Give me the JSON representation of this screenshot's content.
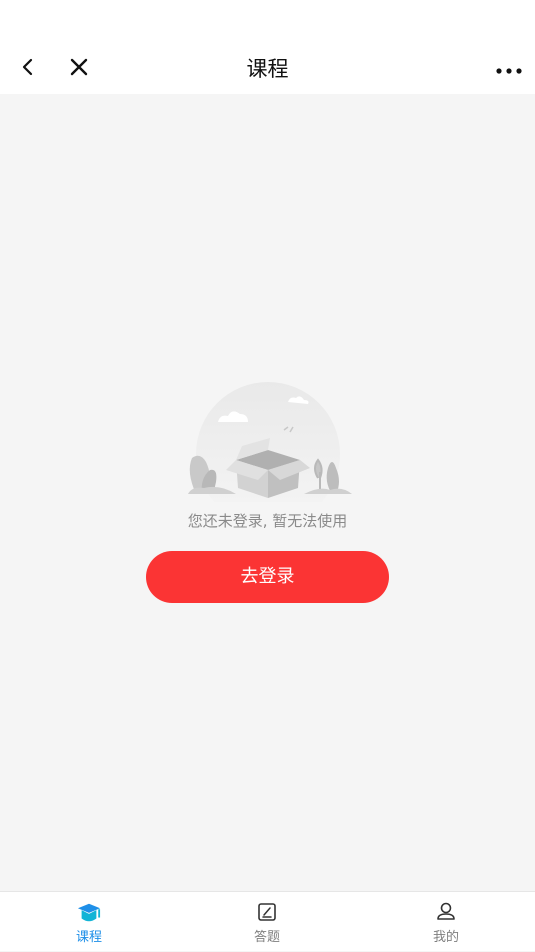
{
  "navbar": {
    "title": "课程",
    "back_icon": "chevron-left-icon",
    "close_icon": "close-icon",
    "more_icon": "more-horizontal-icon"
  },
  "empty_state": {
    "illustration": "empty-box-illustration",
    "message": "您还未登录, 暂无法使用",
    "login_button": "去登录"
  },
  "tabbar": {
    "items": [
      {
        "label": "课程",
        "icon": "graduation-cap-icon",
        "active": true
      },
      {
        "label": "答题",
        "icon": "answer-sheet-icon",
        "active": false
      },
      {
        "label": "我的",
        "icon": "user-icon",
        "active": false
      }
    ]
  },
  "colors": {
    "accent": "#fb3434",
    "active_tab": "#1e8fe8",
    "inactive_tab": "#7f7f7f",
    "background": "#f5f5f5"
  }
}
